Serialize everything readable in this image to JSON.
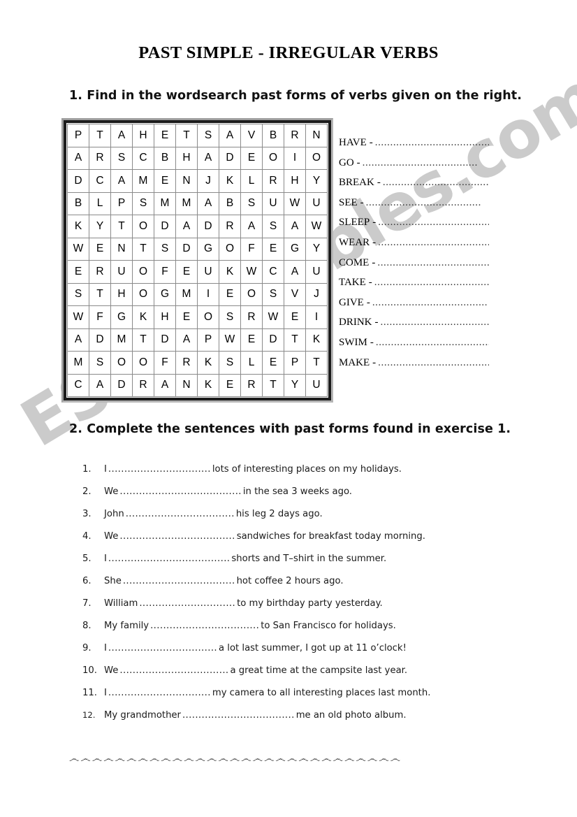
{
  "document": {
    "title": "PAST SIMPLE  - IRREGULAR VERBS",
    "watermark": "ESLprintables.com",
    "footer_ornament": "෴෴෴෴෴෴෴෴෴෴෴෴෴෴෴෴෴෴෴෴෴෴෴෴෴෴෴෴෴"
  },
  "exercise1": {
    "instruction": "1. Find in the wordsearch past forms of verbs given on the right.",
    "wordsearch": {
      "rows": 12,
      "cols": 12,
      "grid": [
        [
          "P",
          "T",
          "A",
          "H",
          "E",
          "T",
          "S",
          "A",
          "V",
          "B",
          "R",
          "N"
        ],
        [
          "A",
          "R",
          "S",
          "C",
          "B",
          "H",
          "A",
          "D",
          "E",
          "O",
          "I",
          "O"
        ],
        [
          "D",
          "C",
          "A",
          "M",
          "E",
          "N",
          "J",
          "K",
          "L",
          "R",
          "H",
          "Y"
        ],
        [
          "B",
          "L",
          "P",
          "S",
          "M",
          "M",
          "A",
          "B",
          "S",
          "U",
          "W",
          "U"
        ],
        [
          "K",
          "Y",
          "T",
          "O",
          "D",
          "A",
          "D",
          "R",
          "A",
          "S",
          "A",
          "W"
        ],
        [
          "W",
          "E",
          "N",
          "T",
          "S",
          "D",
          "G",
          "O",
          "F",
          "E",
          "G",
          "Y"
        ],
        [
          "E",
          "R",
          "U",
          "O",
          "F",
          "E",
          "U",
          "K",
          "W",
          "C",
          "A",
          "U"
        ],
        [
          "S",
          "T",
          "H",
          "O",
          "G",
          "M",
          "I",
          "E",
          "O",
          "S",
          "V",
          "J"
        ],
        [
          "W",
          "F",
          "G",
          "K",
          "H",
          "E",
          "O",
          "S",
          "R",
          "W",
          "E",
          "I"
        ],
        [
          "A",
          "D",
          "M",
          "T",
          "D",
          "A",
          "P",
          "W",
          "E",
          "D",
          "T",
          "K"
        ],
        [
          "M",
          "S",
          "O",
          "O",
          "F",
          "R",
          "K",
          "S",
          "L",
          "E",
          "P",
          "T"
        ],
        [
          "C",
          "A",
          "D",
          "R",
          "A",
          "N",
          "K",
          "E",
          "R",
          "T",
          "Y",
          "U"
        ]
      ]
    },
    "verbs": [
      {
        "label": "HAVE",
        "dash": "-",
        "answer": ""
      },
      {
        "label": "GO",
        "dash": "-",
        "answer": ""
      },
      {
        "label": "BREAK",
        "dash": "-",
        "answer": ""
      },
      {
        "label": "SEE",
        "dash": "-",
        "answer": ""
      },
      {
        "label": "SLEEP",
        "dash": "-",
        "answer": ""
      },
      {
        "label": "WEAR",
        "dash": "-",
        "answer": ""
      },
      {
        "label": "COME",
        "dash": "-",
        "answer": ""
      },
      {
        "label": "TAKE",
        "dash": "-",
        "answer": ""
      },
      {
        "label": "GIVE",
        "dash": "-",
        "answer": ""
      },
      {
        "label": "DRINK",
        "dash": "-",
        "answer": ""
      },
      {
        "label": "SWIM",
        "dash": "-",
        "answer": ""
      },
      {
        "label": "MAKE",
        "dash": "-",
        "answer": ""
      }
    ],
    "dots_fill": "......................................"
  },
  "exercise2": {
    "instruction": "2. Complete the sentences with past forms found in exercise 1.",
    "sentences": [
      {
        "num": "1.",
        "before": "I ",
        "dots": "................................",
        "after": " lots of interesting places on my holidays."
      },
      {
        "num": "2.",
        "before": "We ",
        "dots": "......................................",
        "after": " in the sea 3 weeks ago."
      },
      {
        "num": "3.",
        "before": "John ",
        "dots": "..................................",
        "after": " his leg 2 days ago."
      },
      {
        "num": "4.",
        "before": "We ",
        "dots": "....................................",
        "after": " sandwiches for breakfast today morning."
      },
      {
        "num": "5.",
        "before": "I ",
        "dots": "......................................",
        "after": " shorts and T–shirt in the summer."
      },
      {
        "num": "6.",
        "before": "She ",
        "dots": "...................................",
        "after": " hot coffee 2 hours ago."
      },
      {
        "num": "7.",
        "before": "William ",
        "dots": "..............................",
        "after": " to my birthday party yesterday."
      },
      {
        "num": "8.",
        "before": "My family ",
        "dots": "..................................",
        "after": " to San Francisco for holidays."
      },
      {
        "num": "9.",
        "before": "I ",
        "dots": "..................................",
        "after": "a lot last summer, I got up at 11 o’clock!"
      },
      {
        "num": "10.",
        "before": "We ",
        "dots": "..................................",
        "after": " a great time at the campsite last year."
      },
      {
        "num": "11.",
        "before": "I ",
        "dots": "................................",
        "after": " my camera to all interesting places last month."
      },
      {
        "num": "12.",
        "before": "My grandmother ",
        "dots": "...................................",
        "after": " me an old photo album."
      }
    ]
  }
}
